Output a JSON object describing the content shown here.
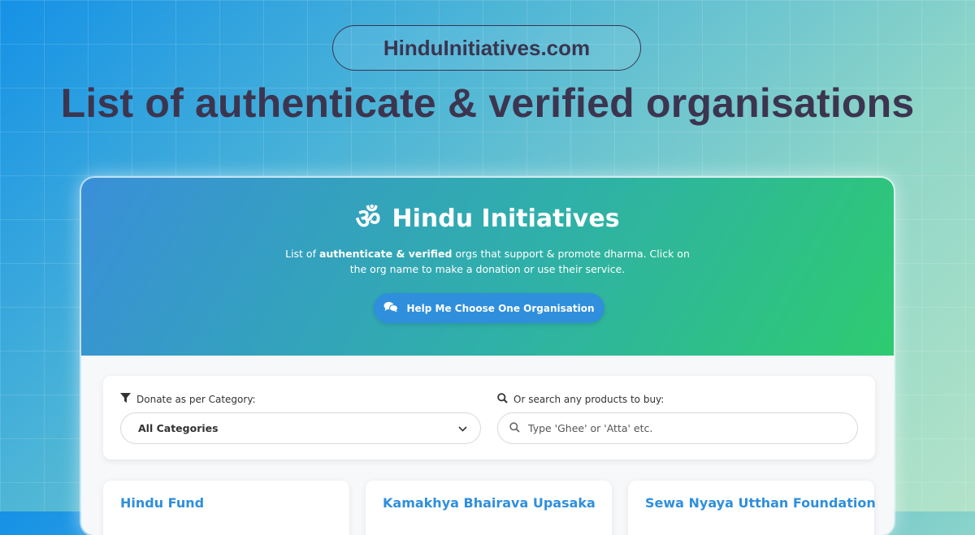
{
  "site": {
    "domain": "HinduInitiatives.com",
    "hero_title": "List of authenticate & verified organisations"
  },
  "header": {
    "om_symbol": "ॐ",
    "brand_name": "Hindu Initiatives",
    "tagline_pre": "List of ",
    "tagline_bold": "authenticate & verified",
    "tagline_post": " orgs that support & promote dharma. Click on the org name to make a donation or use their service.",
    "help_button": "Help Me Choose One Organisation"
  },
  "filters": {
    "category_label": "Donate as per Category:",
    "category_value": "All Categories",
    "search_label": "Or search any products to buy:",
    "search_placeholder": "Type 'Ghee' or 'Atta' etc.",
    "search_value": ""
  },
  "organisations": [
    {
      "name": "Hindu Fund"
    },
    {
      "name": "Kamakhya Bhairava Upasaka"
    },
    {
      "name": "Sewa Nyaya Utthan Foundation"
    }
  ],
  "colors": {
    "accent": "#2f8fdc",
    "title": "#3c3550",
    "header_start": "#3a8fd9",
    "header_end": "#2ecb70"
  },
  "icons": {
    "brand": "om-icon",
    "help": "chat-bubbles-icon",
    "category": "filter-icon",
    "search": "search-icon",
    "select": "chevron-down-icon"
  }
}
